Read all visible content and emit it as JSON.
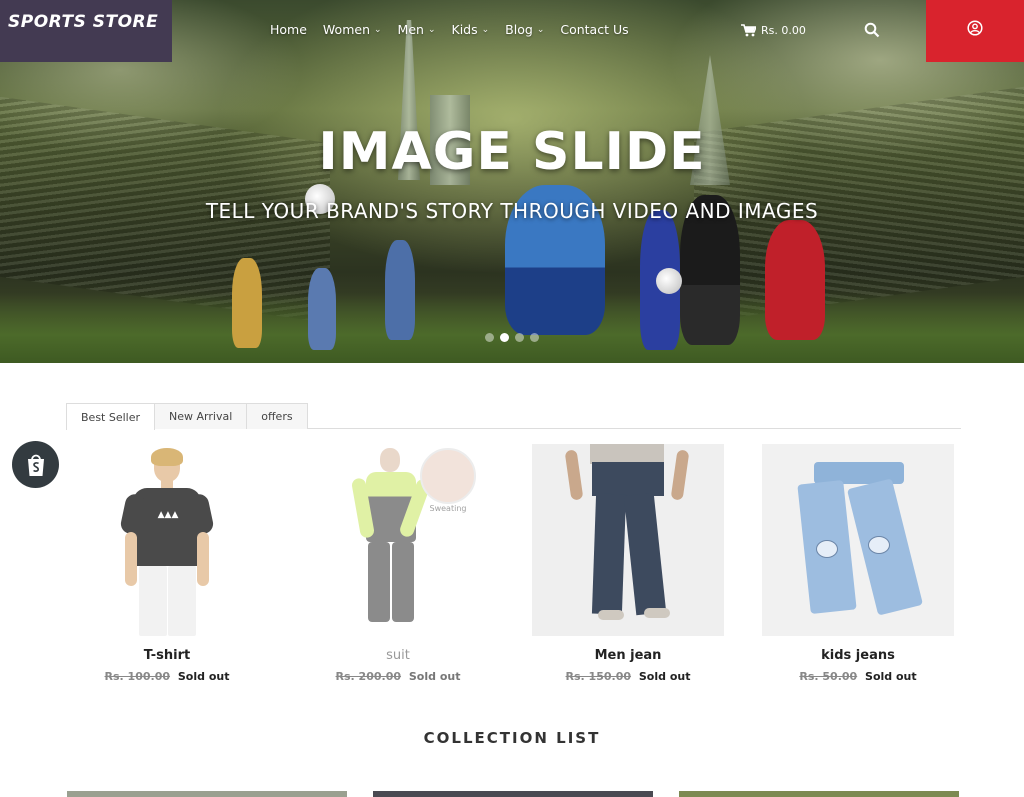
{
  "header": {
    "logo_text": "SPORTS STORE",
    "nav": [
      {
        "label": "Home",
        "has_dropdown": false
      },
      {
        "label": "Women",
        "has_dropdown": true
      },
      {
        "label": "Men",
        "has_dropdown": true
      },
      {
        "label": "Kids",
        "has_dropdown": true
      },
      {
        "label": "Blog",
        "has_dropdown": true
      },
      {
        "label": "Contact Us",
        "has_dropdown": false
      }
    ],
    "cart_total": "Rs. 0.00",
    "icons": {
      "cart": "cart-icon",
      "search": "search-icon",
      "account": "account-icon"
    },
    "account_bg": "#d9232d",
    "logo_bg": "#433a52"
  },
  "hero": {
    "title": "IMAGE SLIDE",
    "subtitle": "TELL YOUR BRAND'S STORY THROUGH VIDEO AND IMAGES",
    "slide_count": 4,
    "active_slide": 2
  },
  "tabs": [
    {
      "label": "Best Seller",
      "active": true
    },
    {
      "label": "New Arrival",
      "active": false
    },
    {
      "label": "offers",
      "active": false
    }
  ],
  "products": [
    {
      "name": "T-shirt",
      "old_price": "Rs. 100.00",
      "status": "Sold out",
      "image": "tshirt-image"
    },
    {
      "name": "suit",
      "old_price": "Rs. 200.00",
      "status": "Sold out",
      "image": "suit-image",
      "badge_text": "Sweating"
    },
    {
      "name": "Men jean",
      "old_price": "Rs. 150.00",
      "status": "Sold out",
      "image": "men-jean-image"
    },
    {
      "name": "kids jeans",
      "old_price": "Rs. 50.00",
      "status": "Sold out",
      "image": "kids-jeans-image"
    }
  ],
  "collection": {
    "title": "COLLECTION LIST"
  }
}
